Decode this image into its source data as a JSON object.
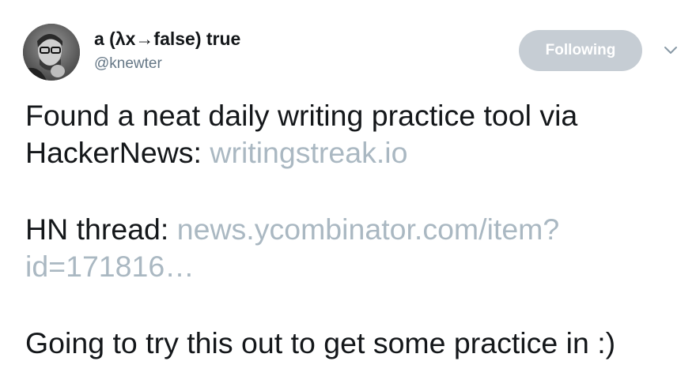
{
  "author": {
    "display_name": "a (λx→false) true",
    "handle": "@knewter"
  },
  "follow_button": {
    "label": "Following"
  },
  "menu": {
    "icon": "chevron-down-icon"
  },
  "tweet": {
    "line1": "Found a neat daily writing practice tool via",
    "line2_text": "HackerNews: ",
    "line2_link": "writingstreak.io",
    "line3_text": "HN thread: ",
    "line3_link": "news.ycombinator.com/item?",
    "line4_link": "id=171816…",
    "line5": "Going to try this out to get some practice in :)"
  },
  "colors": {
    "text": "#14171a",
    "link": "#aab8c2",
    "handle": "#657786",
    "following_bg": "#c6cdd4"
  }
}
